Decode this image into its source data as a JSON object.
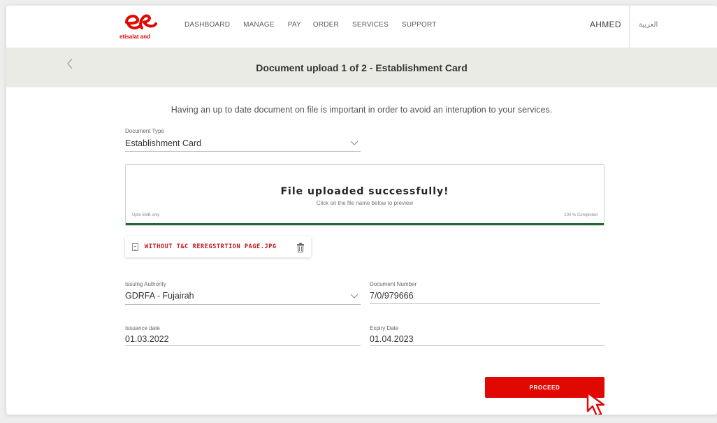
{
  "brand": {
    "logo_text": "etisalat and",
    "accent": "#e00800"
  },
  "nav": {
    "items": [
      "DASHBOARD",
      "MANAGE",
      "PAY",
      "ORDER",
      "SERVICES",
      "SUPPORT"
    ]
  },
  "header": {
    "user": "AHMED",
    "language": "العربية"
  },
  "page": {
    "title": "Document upload 1 of 2 - Establishment Card",
    "back_icon": "chevron-left-icon"
  },
  "intro": "Having an up to date document on file is important in order to avoid an interuption to your services.",
  "document_type": {
    "label": "Document Type",
    "value": "Establishment Card"
  },
  "upload": {
    "title": "File uploaded successfully!",
    "subtitle": "Click on the file name below to preview",
    "limit": "Upto 5MB only",
    "progress_text": "100 % Completed",
    "progress": 1.0,
    "progress_color": "#1f6b2b"
  },
  "file": {
    "name": "WITHOUT T&C REREGSTRTION PAGE.JPG"
  },
  "issuing_authority": {
    "label": "Issuing Authority",
    "value": "GDRFA - Fujairah"
  },
  "document_number": {
    "label": "Document Number",
    "value": "7/0/979666"
  },
  "issuance_date": {
    "label": "Issuance date",
    "value": "01.03.2022"
  },
  "expiry_date": {
    "label": "Expiry Date",
    "value": "01.04.2023"
  },
  "actions": {
    "proceed": "PROCEED"
  }
}
